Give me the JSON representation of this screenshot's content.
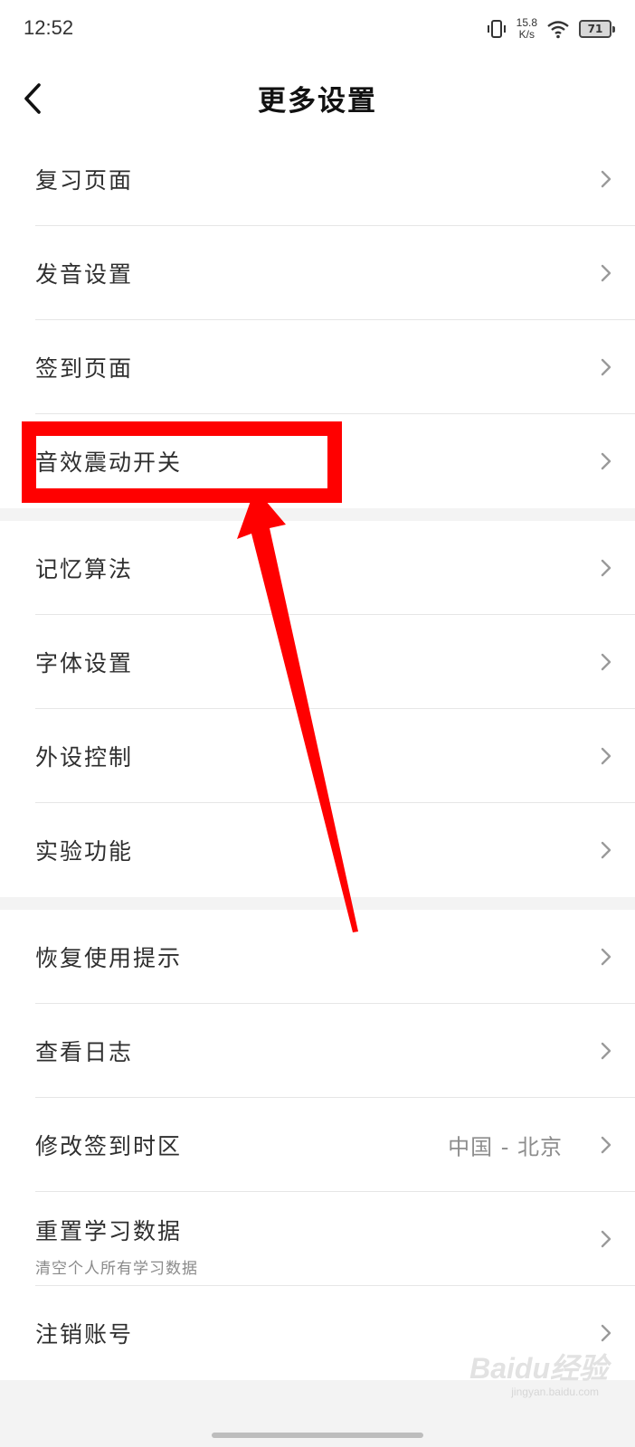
{
  "status_bar": {
    "time": "12:52",
    "speed_value": "15.8",
    "speed_unit": "K/s",
    "battery": "71"
  },
  "header": {
    "title": "更多设置"
  },
  "sections": [
    {
      "items": [
        {
          "label": "复习页面"
        },
        {
          "label": "发音设置"
        },
        {
          "label": "签到页面"
        },
        {
          "label": "音效震动开关"
        }
      ]
    },
    {
      "items": [
        {
          "label": "记忆算法"
        },
        {
          "label": "字体设置"
        },
        {
          "label": "外设控制"
        },
        {
          "label": "实验功能"
        }
      ]
    },
    {
      "items": [
        {
          "label": "恢复使用提示"
        },
        {
          "label": "查看日志"
        },
        {
          "label": "修改签到时区",
          "value": "中国 - 北京"
        },
        {
          "label": "重置学习数据",
          "subtitle": "清空个人所有学习数据"
        },
        {
          "label": "注销账号"
        }
      ]
    }
  ],
  "watermark": {
    "brand": "Baidu经验",
    "url": "jingyan.baidu.com"
  },
  "colors": {
    "annotation": "#ff0000",
    "section_gap": "#f3f3f3",
    "chevron": "#9a9a9a"
  }
}
